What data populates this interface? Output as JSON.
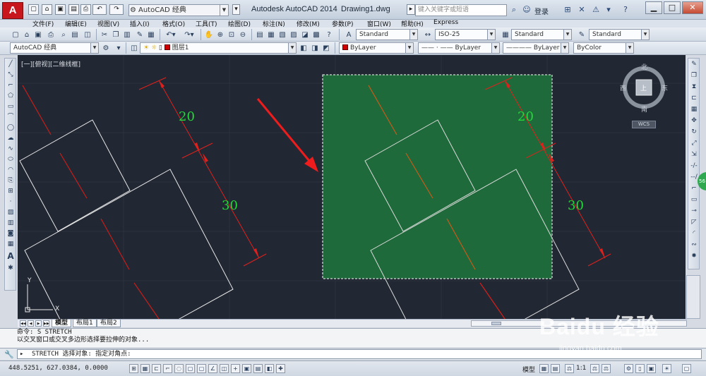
{
  "titlebar": {
    "app_logo": "A",
    "workspace": "AutoCAD 经典",
    "app_title": "Autodesk AutoCAD 2014",
    "doc_title": "Drawing1.dwg",
    "search_placeholder": "键入关键字或短语",
    "login": "登录"
  },
  "menu": [
    "文件(F)",
    "编辑(E)",
    "视图(V)",
    "插入(I)",
    "格式(O)",
    "工具(T)",
    "绘图(D)",
    "标注(N)",
    "修改(M)",
    "参数(P)",
    "窗口(W)",
    "帮助(H)",
    "Express"
  ],
  "styles": {
    "text_style": "Standard",
    "dim_style": "ISO-25",
    "table_style": "Standard",
    "mleader_style": "Standard"
  },
  "layers": {
    "workspace": "AutoCAD 经典",
    "current_layer": "图层1",
    "color": "ByLayer",
    "linetype": "ByLayer",
    "lineweight": "ByLayer",
    "plotstyle": "ByColor"
  },
  "viewport": {
    "label": "[一][俯视][二维线框]",
    "compass": {
      "north": "北",
      "south": "南",
      "east": "东",
      "west": "西",
      "center": "上"
    },
    "wcs": "WCS",
    "dims": {
      "left_top": "20",
      "left_bottom": "30",
      "right_top": "20",
      "right_bottom": "30"
    },
    "ucs": {
      "x": "X",
      "y": "Y"
    }
  },
  "layout_tabs": [
    "模型",
    "布局1",
    "布局2"
  ],
  "command": {
    "history": [
      "命令: S STRETCH",
      "以交叉窗口或交叉多边形选择要拉伸的对象..."
    ],
    "prompt": "STRETCH 选择对象: 指定对角点:"
  },
  "status": {
    "coords": "448.5251, 627.0384, 0.0000",
    "model": "模型",
    "scale": "1:1"
  },
  "watermark": {
    "main": "Baidu 经验",
    "sub": "jingyan.baidu.com"
  },
  "colors": {
    "canvas": "#222833",
    "selection": "#1f6a3a",
    "dimension": "#e0201c",
    "dim_text": "#25d83a"
  }
}
